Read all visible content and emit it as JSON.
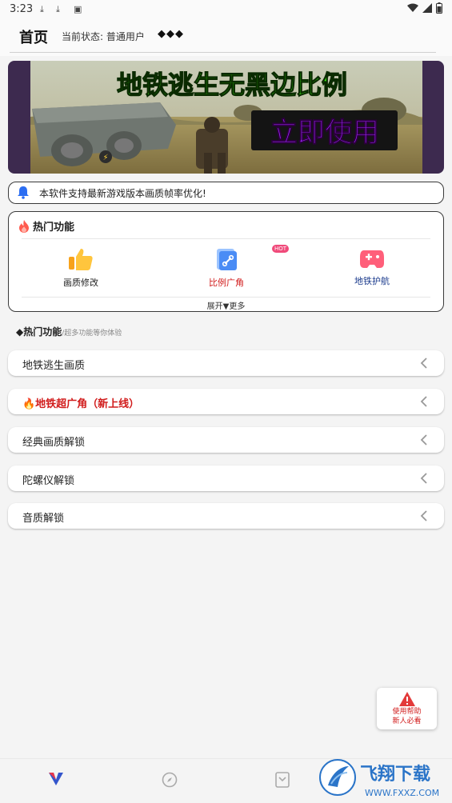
{
  "statusbar": {
    "time": "3:23"
  },
  "topbar": {
    "title": "首页",
    "status": "当前状态: 普通用户",
    "diamonds": "◆◆◆"
  },
  "banner": {
    "headline": "地铁逃生无黑边比例",
    "cta": "立即使用"
  },
  "notice": {
    "text": "本软件支持最新游戏版本画质帧率优化!"
  },
  "hot": {
    "title": "热门功能",
    "badge": "HOT",
    "features": [
      {
        "label": "画质修改",
        "color": "#222222"
      },
      {
        "label": "比例广角",
        "color": "#d11b1b"
      },
      {
        "label": "地铁护航",
        "color": "#1a3a8c"
      }
    ],
    "expand": "展开▼更多"
  },
  "section": {
    "title": "◆热门功能",
    "subtitle": "/超多功能等你体验"
  },
  "list": [
    {
      "label": "地铁逃生画质"
    },
    {
      "label": "🔥地铁超广角（新上线）"
    },
    {
      "label": "经典画质解锁"
    },
    {
      "label": "陀螺仪解锁"
    },
    {
      "label": "音质解锁"
    }
  ],
  "help": {
    "line1": "使用帮助",
    "line2": "新人必看"
  },
  "watermark": {
    "brand": "飞翔下载",
    "url": "WWW.FXXZ.COM"
  },
  "colors": {
    "accent_red": "#d11b1b",
    "card_border": "#3a3a3a",
    "banner_text": "#39ff14"
  }
}
